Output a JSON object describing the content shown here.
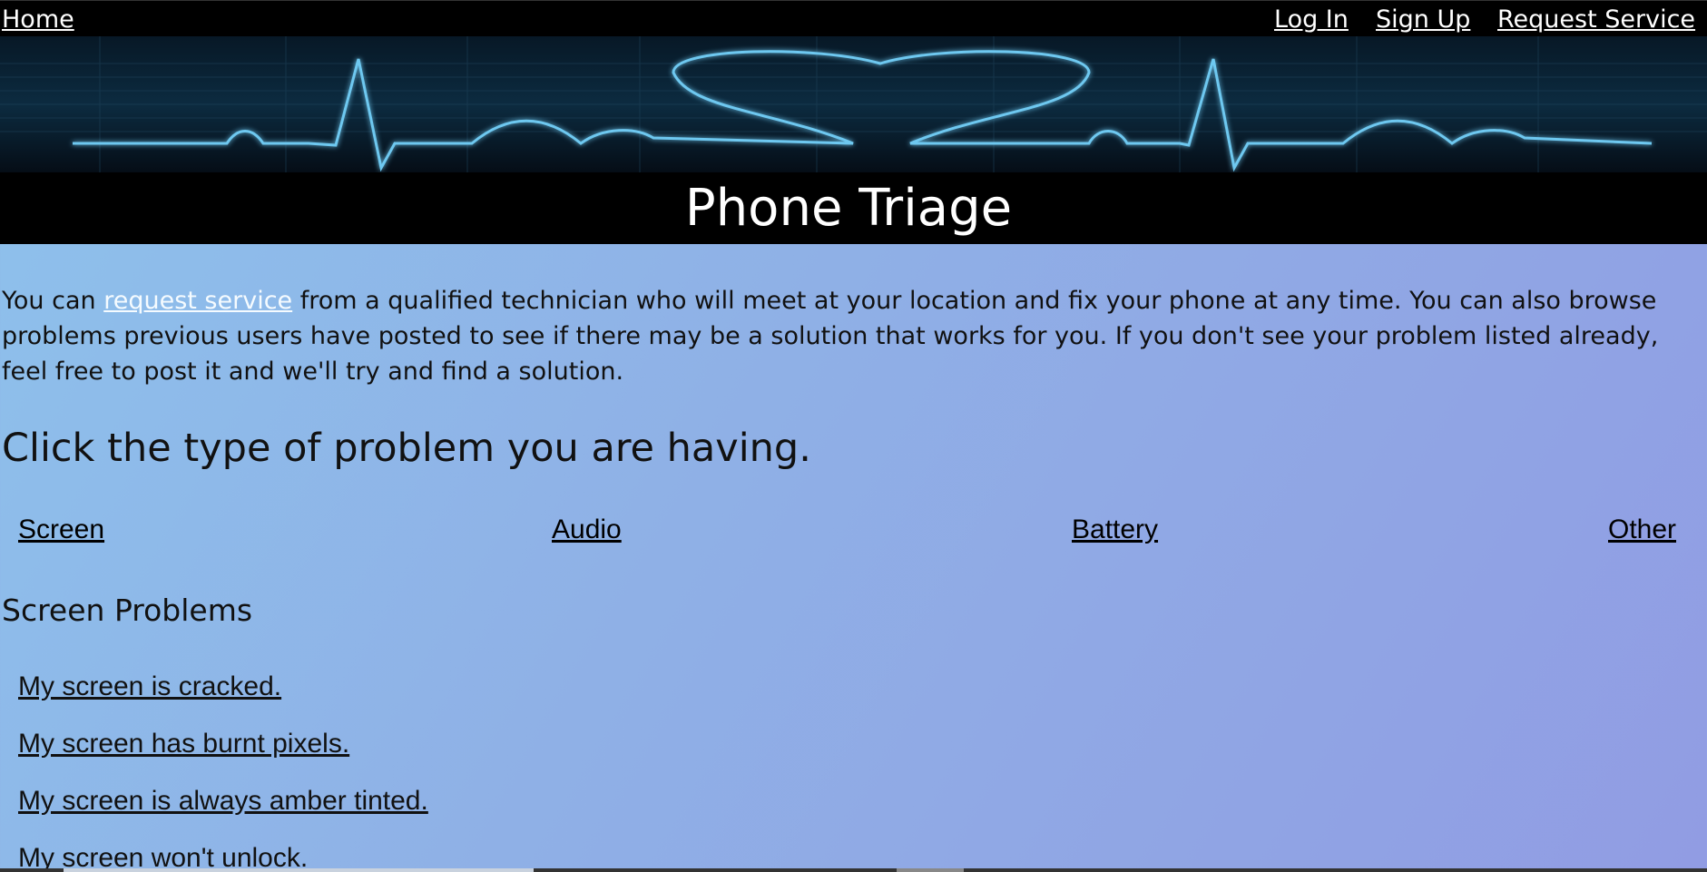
{
  "nav": {
    "home": "Home",
    "login": "Log In",
    "signup": "Sign Up",
    "request_service": "Request Service"
  },
  "header": {
    "title": "Phone Triage"
  },
  "intro": {
    "before_link": "You can ",
    "link_text": "request service",
    "after_link": " from a qualified technician who will meet at your location and fix your phone at any time. You can also browse problems previous users have posted to see if there may be a solution that works for you. If you don't see your problem listed already, feel free to post it and we'll try and find a solution."
  },
  "categories": {
    "heading": "Click the type of problem you are having.",
    "items": [
      "Screen",
      "Audio",
      "Battery",
      "Other"
    ]
  },
  "problems": {
    "heading": "Screen Problems",
    "items": [
      "My screen is cracked.",
      "My screen has burnt pixels.",
      "My screen is always amber tinted.",
      "My screen won't unlock."
    ]
  },
  "colors": {
    "banner_glow": "#6ec8f0",
    "background_start": "#8ec2ec",
    "background_end": "#919ce3"
  }
}
